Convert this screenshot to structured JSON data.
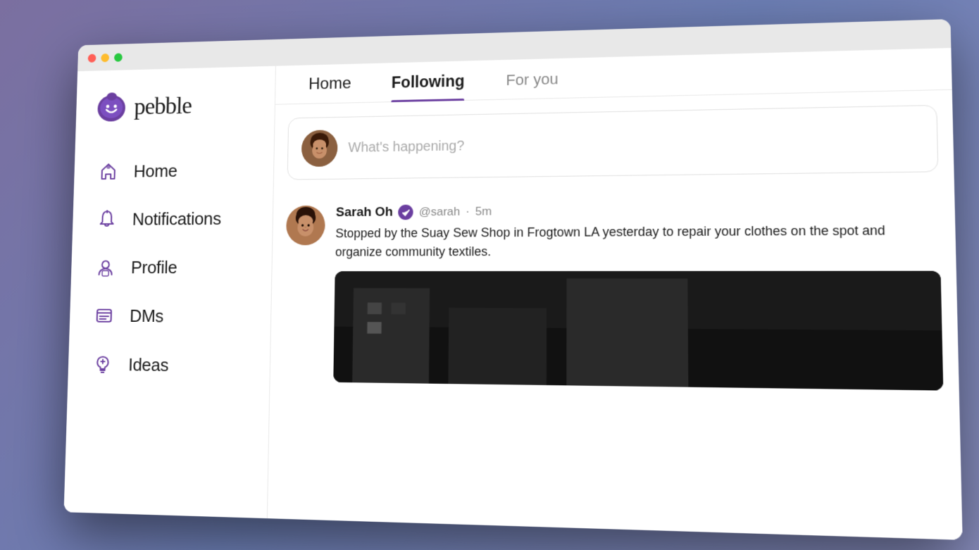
{
  "window": {
    "title": "Pebble",
    "traffic_lights": {
      "close": "Close",
      "minimize": "Minimize",
      "maximize": "Maximize"
    }
  },
  "sidebar": {
    "logo_text": "pebble",
    "nav_items": [
      {
        "id": "home",
        "label": "Home",
        "icon": "home-icon"
      },
      {
        "id": "notifications",
        "label": "Notifications",
        "icon": "bell-icon"
      },
      {
        "id": "profile",
        "label": "Profile",
        "icon": "profile-icon"
      },
      {
        "id": "dms",
        "label": "DMs",
        "icon": "dm-icon"
      },
      {
        "id": "ideas",
        "label": "Ideas",
        "icon": "ideas-icon"
      }
    ]
  },
  "main": {
    "tabs": [
      {
        "id": "home",
        "label": "Home",
        "active": false
      },
      {
        "id": "following",
        "label": "Following",
        "active": true
      },
      {
        "id": "for-you",
        "label": "For you",
        "active": false
      }
    ],
    "composer": {
      "placeholder": "What's happening?"
    },
    "posts": [
      {
        "id": "post-1",
        "author_name": "Sarah Oh",
        "author_handle": "@sarah",
        "time": "5m",
        "verified": true,
        "text": "Stopped by the Suay Sew Shop in Frogtown LA yesterday to repair your clothes on the spot and organize community textiles."
      }
    ]
  }
}
